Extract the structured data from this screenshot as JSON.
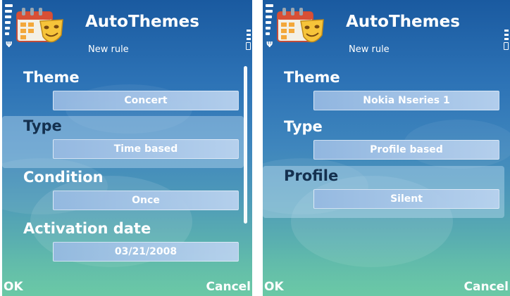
{
  "screens": [
    {
      "app_title": "AutoThemes",
      "subtitle": "New rule",
      "items": [
        {
          "label": "Theme",
          "value": "Concert",
          "selected": false
        },
        {
          "label": "Type",
          "value": "Time based",
          "selected": true
        },
        {
          "label": "Condition",
          "value": "Once",
          "selected": false
        },
        {
          "label": "Activation date",
          "value": "03/21/2008",
          "selected": false
        }
      ],
      "softkeys": {
        "left": "OK",
        "right": "Cancel"
      }
    },
    {
      "app_title": "AutoThemes",
      "subtitle": "New rule",
      "items": [
        {
          "label": "Theme",
          "value": "Nokia Nseries 1",
          "selected": false
        },
        {
          "label": "Type",
          "value": "Profile based",
          "selected": false
        },
        {
          "label": "Profile",
          "value": "Silent",
          "selected": true
        }
      ],
      "softkeys": {
        "left": "OK",
        "right": "Cancel"
      }
    }
  ],
  "icons": {
    "app": "calendar-theater-mask-icon",
    "signal": "signal-strength-icon",
    "battery": "battery-icon"
  },
  "colors": {
    "background_top": "#1a5aa0",
    "background_bottom": "#63bda8",
    "value_box": "#a9c7ea",
    "selected_label": "#14304f",
    "text": "#ffffff"
  }
}
